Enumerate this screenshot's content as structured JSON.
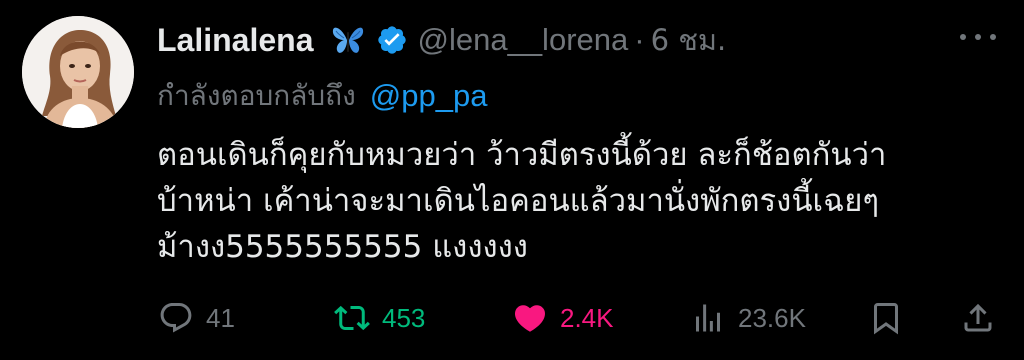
{
  "author": {
    "display_name": "Lalinalena",
    "name_emoji": "butterfly-emoji",
    "verified_icon": "verified-badge-icon",
    "handle": "@lena__lorena",
    "separator": "·",
    "time": "6 ชม."
  },
  "reply": {
    "prefix": "กำลังตอบกลับถึง",
    "mention": "@pp_pa"
  },
  "tweet": {
    "lines": [
      "ตอนเดินก็คุยกับหมวยว่า ว้าวมีตรงนี้ด้วย ละก็ช้อตกันว่า",
      "บ้าหน่า เค้าน่าจะมาเดินไอคอนแล้วมานั่งพักตรงนี้เฉยๆ",
      "ม้างง5555555555 แงงงงง"
    ]
  },
  "actions": {
    "reply_count": "41",
    "retweet_count": "453",
    "like_count": "2.4K",
    "view_count": "23.6K",
    "icons": [
      "reply-icon",
      "retweet-icon",
      "heart-icon",
      "views-icon",
      "bookmark-icon",
      "share-icon"
    ]
  },
  "colors": {
    "background": "#000000",
    "text": "#e7e9ea",
    "muted": "#71767b",
    "accent_blue": "#1d9bf0",
    "retweet_green": "#00ba7c",
    "like_pink": "#f91880"
  }
}
